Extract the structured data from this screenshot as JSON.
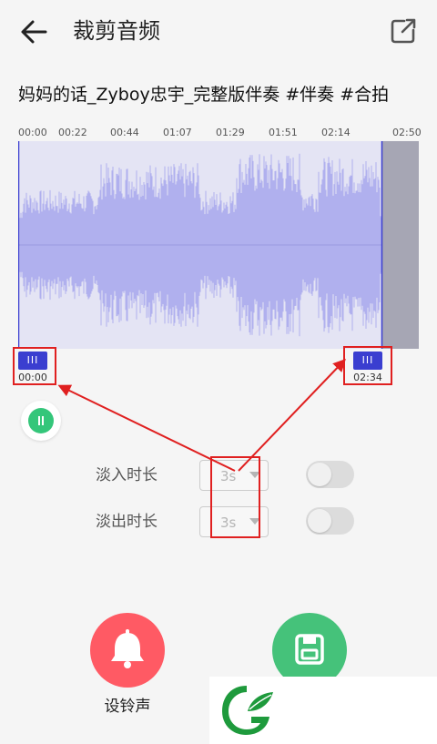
{
  "header": {
    "back_icon": "arrow-left-icon",
    "title": "裁剪音频",
    "export_icon": "external-link-icon"
  },
  "track": {
    "name": "妈妈的话_Zyboy忠宇_完整版伴奏 #伴奏 #合拍"
  },
  "timeline": {
    "ticks": [
      "00:00",
      "00:22",
      "00:44",
      "01:07",
      "01:29",
      "01:51",
      "02:14",
      "02:50"
    ]
  },
  "trim": {
    "start_time": "00:00",
    "end_time": "02:34",
    "handle_glyph": "III"
  },
  "playback": {
    "icon": "pause-icon"
  },
  "fade_in": {
    "label": "淡入时长",
    "value": "3s",
    "enabled": false
  },
  "fade_out": {
    "label": "淡出时长",
    "value": "3s",
    "enabled": false
  },
  "actions": {
    "ringtone_label": "设铃声",
    "ringtone_icon": "bell-icon",
    "save_icon": "save-icon"
  },
  "colors": {
    "waveform": "#b0b0ee",
    "waveform_bg": "#e4e4f4",
    "excluded_region": "#a6a6b4",
    "handle": "#3a3ed0",
    "play_button": "#34c67a",
    "ringtone_button": "#ff5a64",
    "save_button": "#45c27a",
    "annotation": "#e02020"
  }
}
